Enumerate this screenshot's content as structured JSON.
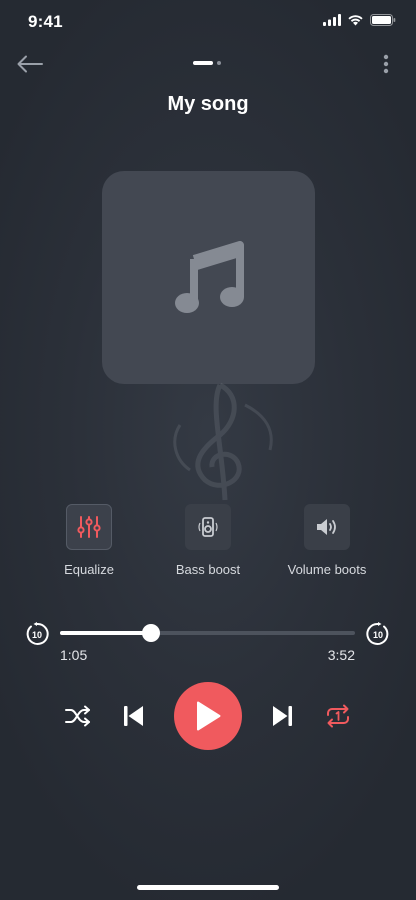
{
  "status_bar": {
    "time": "9:41"
  },
  "header": {
    "title": "My song"
  },
  "effects": [
    {
      "label": "Equalize",
      "icon": "equalizer-icon",
      "active": true
    },
    {
      "label": "Bass boost",
      "icon": "speaker-icon",
      "active": false
    },
    {
      "label": "Volume boots",
      "icon": "volume-icon",
      "active": false
    }
  ],
  "progress": {
    "elapsed": "1:05",
    "total": "3:52",
    "fraction": 0.308,
    "skip_seconds": "10"
  },
  "colors": {
    "accent": "#f05a5e",
    "background": "#2b3039",
    "artwork": "#434852"
  }
}
